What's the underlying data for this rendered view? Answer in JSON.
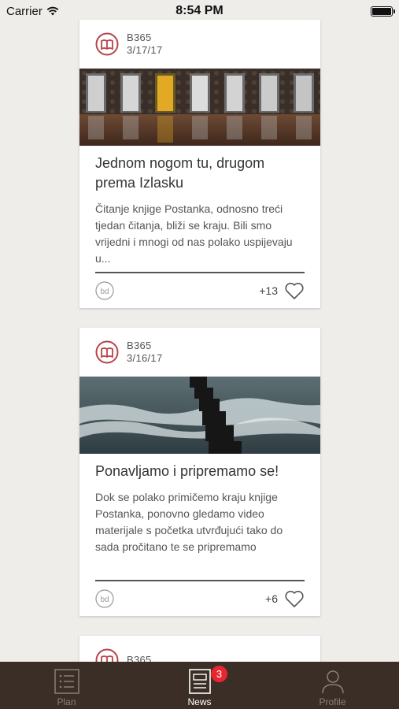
{
  "status_bar": {
    "carrier": "Carrier",
    "time": "8:54 PM"
  },
  "posts": [
    {
      "author": "B365",
      "date": "3/17/17",
      "image": "doors-image",
      "title": "Jednom nogom tu, drugom prema Izlasku",
      "excerpt": "Čitanje knjige Postanka, odnosno treći tjedan čitanja, bliži se kraju. Bili smo vrijedni i mnogi od nas polako uspijevaju u...",
      "likes": "+13"
    },
    {
      "author": "B365",
      "date": "3/16/17",
      "image": "sea-waves-image",
      "title": "Ponavljamo i pripremamo se!",
      "excerpt": "Dok se polako primičemo kraju knjige Postanka, ponovno gledamo video materijale s početka utvrđujući tako do sada pročitano te se pripremamo",
      "likes": "+6"
    },
    {
      "author": "B365"
    }
  ],
  "tab_bar": {
    "tabs": [
      {
        "label": "Plan",
        "icon": "list-icon"
      },
      {
        "label": "News",
        "icon": "news-icon",
        "badge": "3",
        "active": true
      },
      {
        "label": "Profile",
        "icon": "profile-icon"
      }
    ]
  },
  "colors": {
    "background": "#efedea",
    "brand": "#b8434a",
    "tab_bar": "#3b2e27",
    "badge": "#e8262f"
  }
}
